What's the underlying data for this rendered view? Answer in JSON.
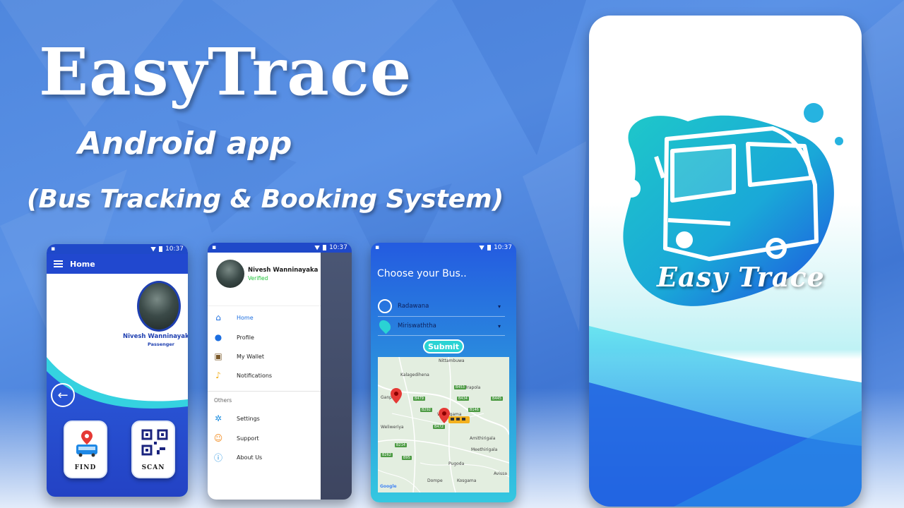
{
  "promo": {
    "title": "EasyTrace",
    "subtitle": "Android app",
    "tagline": "(Bus Tracking & Booking System)"
  },
  "statusbar": {
    "time": "10:37"
  },
  "home_screen": {
    "appbar_title": "Home",
    "user_name": "Nivesh Wanninayaka",
    "user_role": "Passenger",
    "tiles": [
      {
        "label": "FIND"
      },
      {
        "label": "SCAN"
      }
    ]
  },
  "drawer": {
    "user_name": "Nivesh Wanninayaka",
    "status": "Verified",
    "items": [
      {
        "label": "Home",
        "icon": "home-icon"
      },
      {
        "label": "Profile",
        "icon": "profile-icon"
      },
      {
        "label": "My Wallet",
        "icon": "wallet-icon"
      },
      {
        "label": "Notifications",
        "icon": "bell-icon"
      }
    ],
    "section_label": "Others",
    "other_items": [
      {
        "label": "Settings",
        "icon": "gear-icon"
      },
      {
        "label": "Support",
        "icon": "support-icon"
      },
      {
        "label": "About Us",
        "icon": "info-icon"
      }
    ]
  },
  "choose_screen": {
    "title": "Choose your Bus..",
    "from": "Radawana",
    "to": "Miriswaththa",
    "submit_label": "Submit",
    "map_labels": [
      "Nittambuwa",
      "Kalagedihena",
      "Urapola",
      "Weliweriya",
      "Meethirigala",
      "Pugoda",
      "Dompe",
      "Kosgama",
      "Avissa",
      "Amithirigala",
      "Ganpaha",
      "Weliwgama"
    ],
    "route_labels": [
      "B453",
      "B434",
      "B445",
      "B479",
      "B292",
      "B146",
      "B472",
      "B214",
      "B262",
      "B95"
    ],
    "map_attribution": "Google"
  },
  "splash": {
    "logo_text": "Easy Trace"
  },
  "colors": {
    "primary": "#2148cf",
    "accent": "#2ad3d4",
    "verified": "#20c33a"
  }
}
